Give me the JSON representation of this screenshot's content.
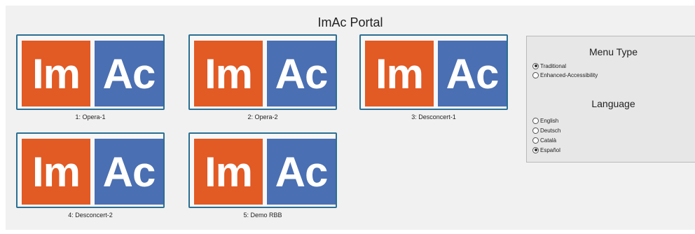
{
  "portal": {
    "title": "ImAc Portal"
  },
  "logo": {
    "left_text": "Im",
    "right_text": "Ac"
  },
  "tiles": [
    {
      "caption": "1: Opera-1"
    },
    {
      "caption": "2: Opera-2"
    },
    {
      "caption": "3: Desconcert-1"
    },
    {
      "caption": "4: Desconcert-2"
    },
    {
      "caption": "5: Demo RBB"
    }
  ],
  "menu_type": {
    "heading": "Menu Type",
    "options": [
      {
        "label": "Traditional",
        "checked": true
      },
      {
        "label": "Enhanced-Accessibility",
        "checked": false
      }
    ]
  },
  "language": {
    "heading": "Language",
    "options": [
      {
        "label": "English",
        "checked": false
      },
      {
        "label": "Deutsch",
        "checked": false
      },
      {
        "label": "Català",
        "checked": false
      },
      {
        "label": "Español",
        "checked": true
      }
    ]
  },
  "colors": {
    "logo_orange": "#e25a24",
    "logo_blue": "#4a6fb2",
    "tile_border": "#2b6f92"
  }
}
